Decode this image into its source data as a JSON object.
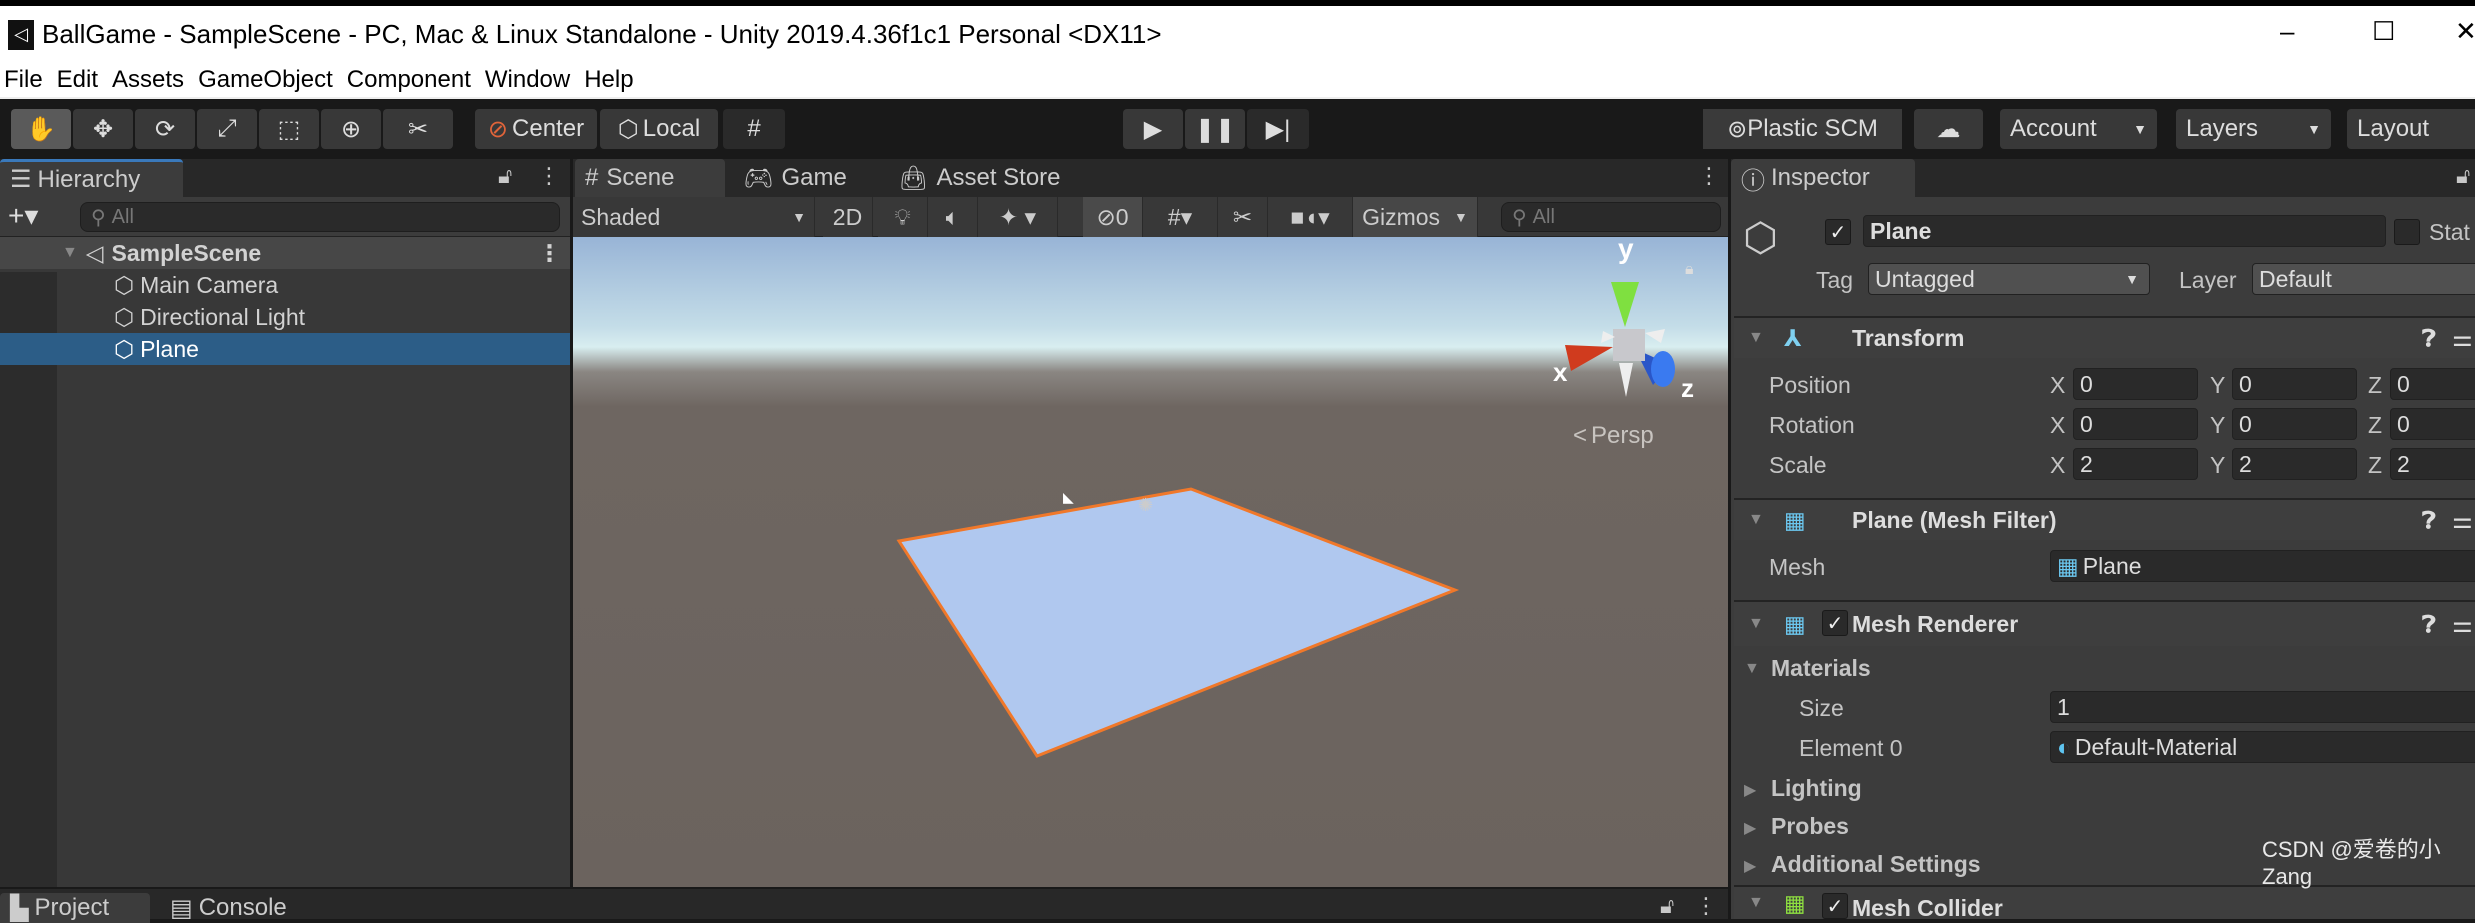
{
  "window": {
    "title": "BallGame - SampleScene - PC, Mac & Linux Standalone - Unity 2019.4.36f1c1 Personal <DX11>",
    "minimize": "–",
    "maximize": "☐",
    "close": "✕"
  },
  "menu": [
    "File",
    "Edit",
    "Assets",
    "GameObject",
    "Component",
    "Window",
    "Help"
  ],
  "toolbar": {
    "center": "Center",
    "local": "Local",
    "plastic": "Plastic SCM",
    "account": "Account",
    "layers": "Layers",
    "layout": "Layout"
  },
  "hierarchy": {
    "tab": "Hierarchy",
    "search_placeholder": "All",
    "scene": "SampleScene",
    "items": [
      "Main Camera",
      "Directional Light",
      "Plane"
    ],
    "selected": "Plane"
  },
  "scene": {
    "tabs": [
      "Scene",
      "Game",
      "Asset Store"
    ],
    "shading": "Shaded",
    "mode2d": "2D",
    "hidden_count": "0",
    "gizmos": "Gizmos",
    "search_placeholder": "All",
    "axis_x": "x",
    "axis_y": "y",
    "axis_z": "z",
    "projection": "Persp"
  },
  "inspector": {
    "tab": "Inspector",
    "name": "Plane",
    "static": "Stat",
    "tag_label": "Tag",
    "tag": "Untagged",
    "layer_label": "Layer",
    "layer": "Default",
    "transform": {
      "title": "Transform",
      "rows": [
        {
          "label": "Position",
          "x": "0",
          "y": "0",
          "z": "0"
        },
        {
          "label": "Rotation",
          "x": "0",
          "y": "0",
          "z": "0"
        },
        {
          "label": "Scale",
          "x": "2",
          "y": "2",
          "z": "2"
        }
      ],
      "axis": [
        "X",
        "Y",
        "Z"
      ]
    },
    "mesh_filter": {
      "title": "Plane (Mesh Filter)",
      "mesh_label": "Mesh",
      "mesh": "Plane"
    },
    "mesh_renderer": {
      "title": "Mesh Renderer",
      "materials": "Materials",
      "size_label": "Size",
      "size": "1",
      "element_label": "Element 0",
      "element": "Default-Material",
      "lighting": "Lighting",
      "probes": "Probes",
      "additional": "Additional Settings"
    },
    "mesh_collider": {
      "title": "Mesh Collider"
    }
  },
  "bottom": {
    "tabs": [
      "Project",
      "Console"
    ]
  },
  "watermark": "CSDN @爱卷的小Zang",
  "colors": {
    "selection": "#2c5d87",
    "accent_tab": "#3a79bb",
    "outline": "#f0782a",
    "plane": "#b0c8ef"
  }
}
